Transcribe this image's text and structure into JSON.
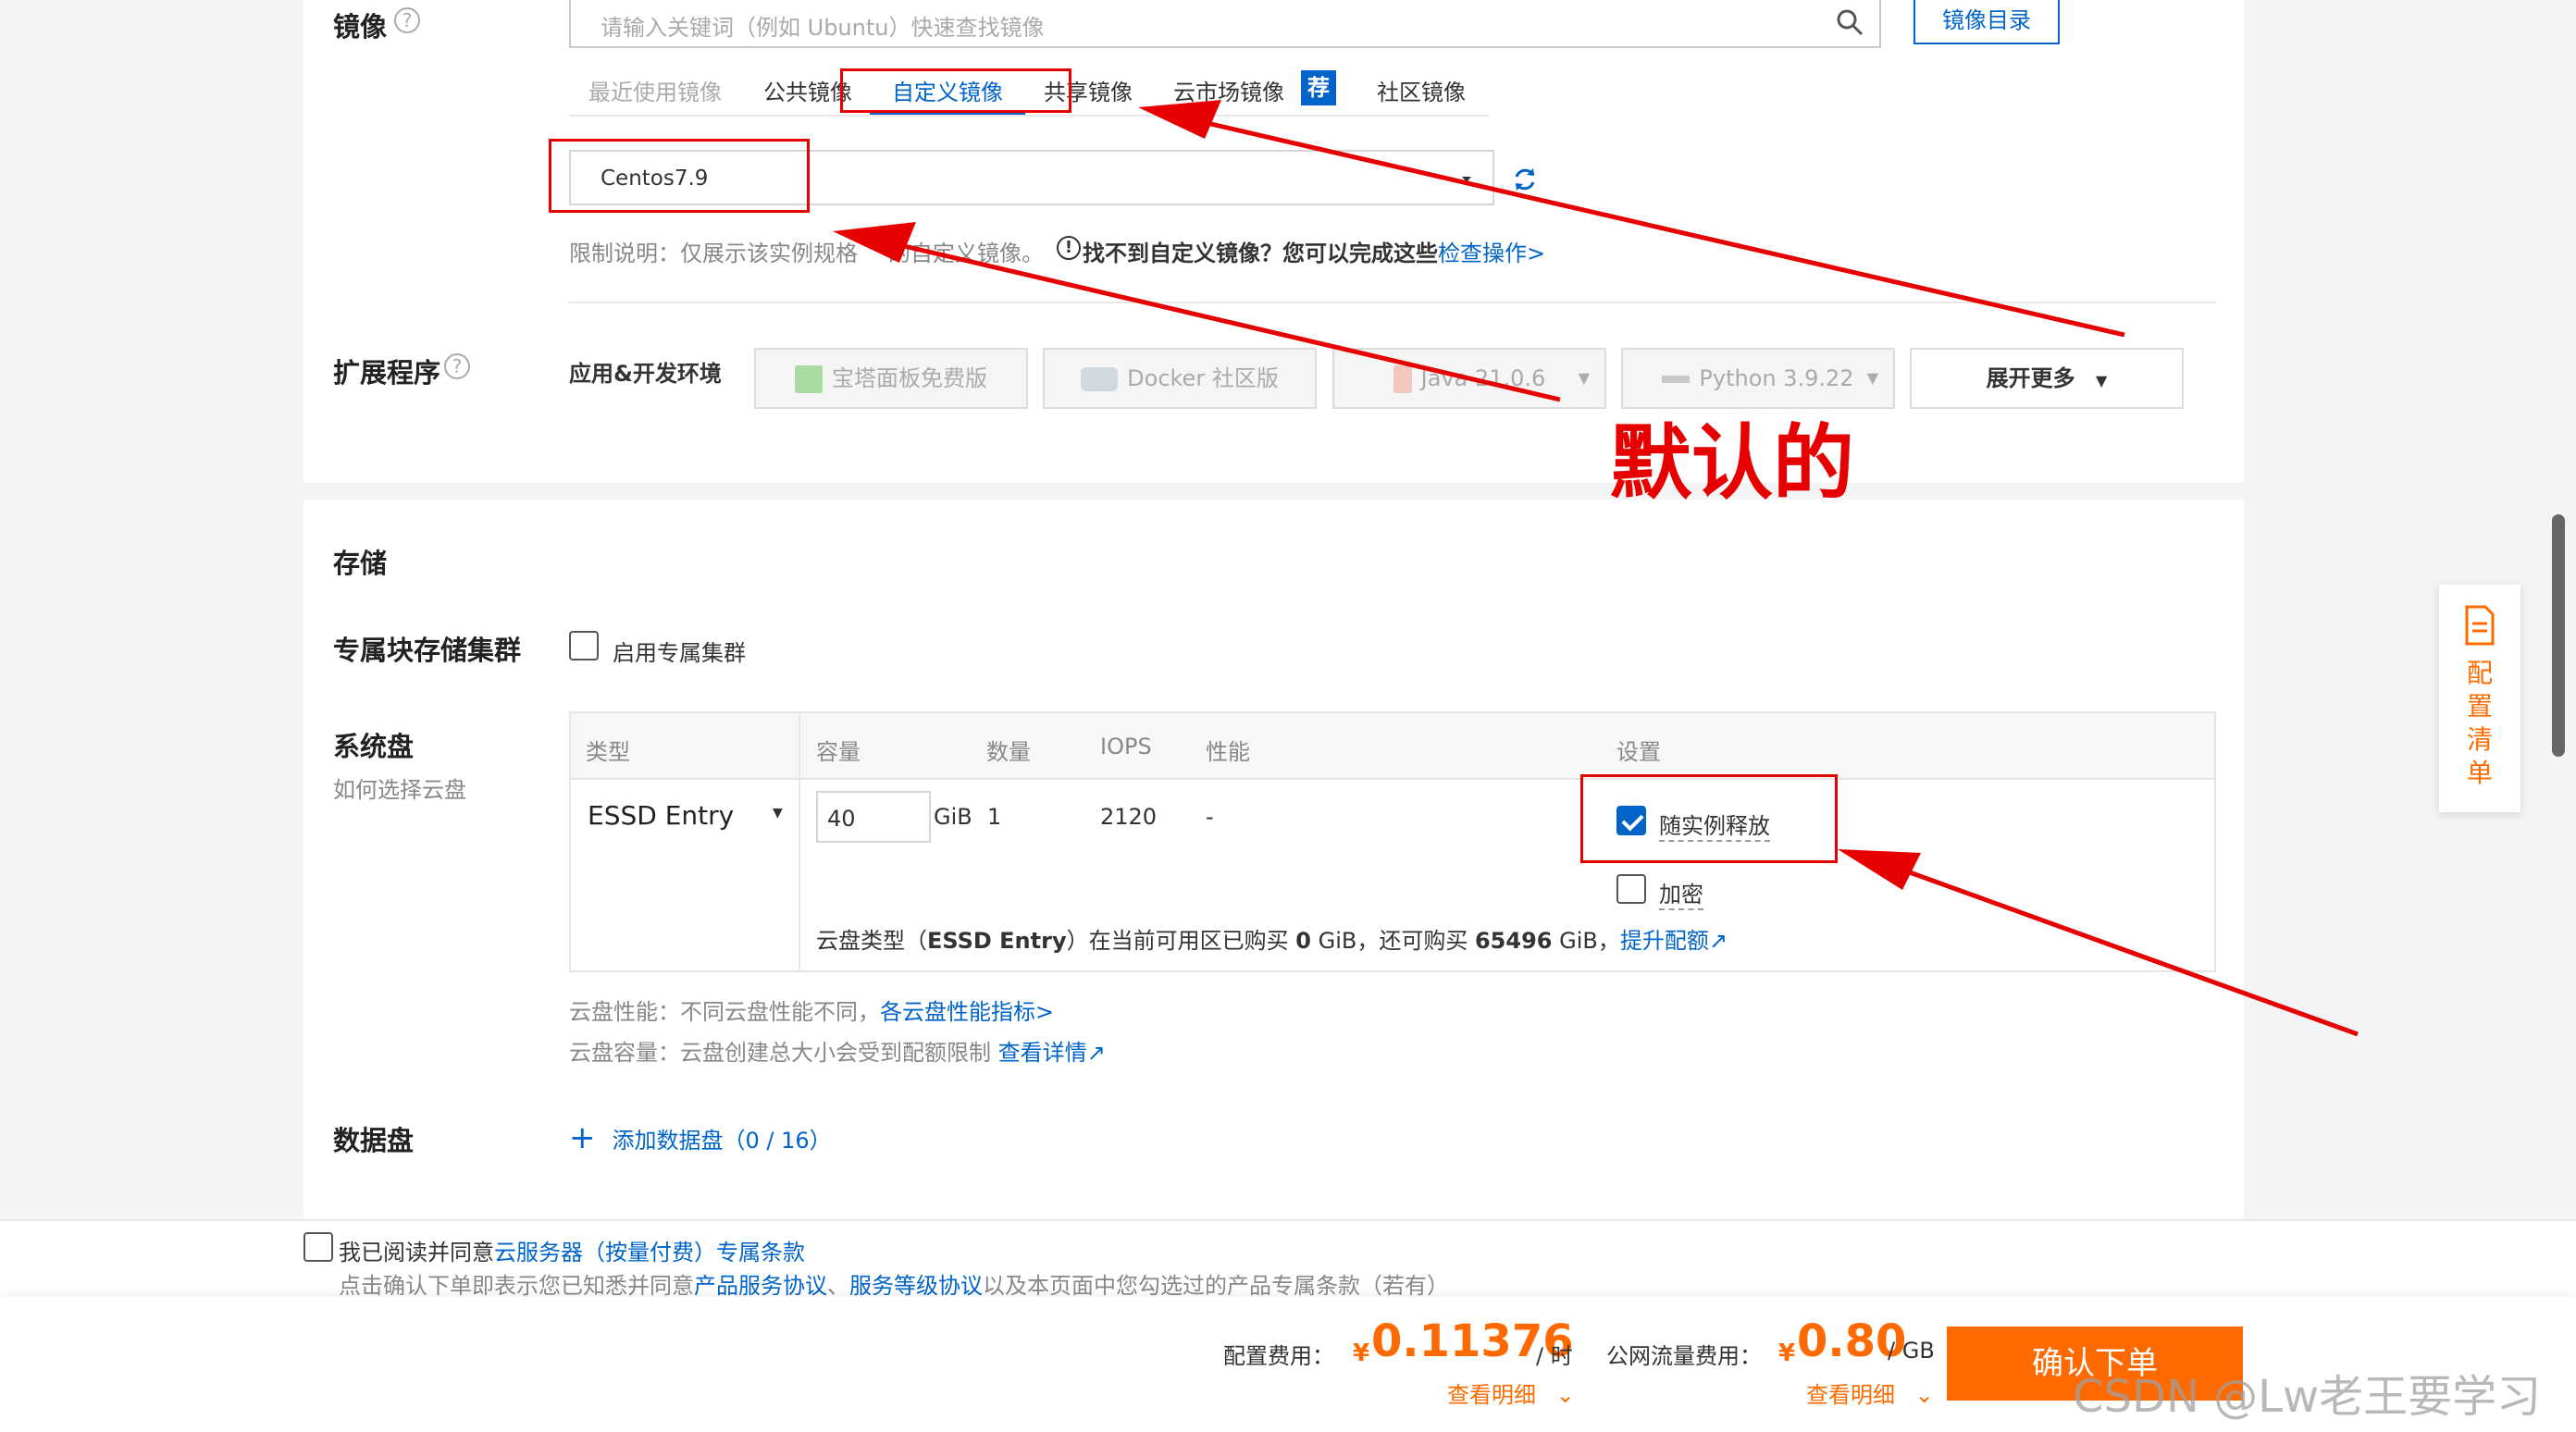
{
  "image_section": {
    "title": "镜像",
    "search_placeholder": "请输入关键词（例如 Ubuntu）快速查找镜像",
    "catalog_button": "镜像目录",
    "tabs": [
      "最近使用镜像",
      "公共镜像",
      "自定义镜像",
      "共享镜像",
      "云市场镜像",
      "社区镜像"
    ],
    "recommend_badge": "荐",
    "selected_image": "Centos7.9",
    "limit_note": "限制说明：仅展示该实例规格",
    "limit_note_tail": "的自定义镜像。",
    "not_found_text": "找不到自定义镜像？您可以完成这些",
    "check_link": "检查操作>"
  },
  "extension_section": {
    "title": "扩展程序",
    "env_label": "应用&开发环境",
    "chips": [
      "宝塔面板免费版",
      "Docker 社区版",
      "Java 21.0.6",
      "Python 3.9.22"
    ],
    "expand_more": "展开更多"
  },
  "annotation": {
    "default_label": "默认的"
  },
  "storage_section": {
    "title": "存储",
    "dedicated_cluster_label": "专属块存储集群",
    "enable_cluster": "启用专属集群",
    "system_disk_title": "系统盘",
    "how_to_choose": "如何选择云盘",
    "table_headers": [
      "类型",
      "容量",
      "数量",
      "IOPS",
      "性能",
      "设置"
    ],
    "disk_type": "ESSD Entry",
    "capacity": "40",
    "capacity_unit": "GiB",
    "quantity": "1",
    "iops": "2120",
    "performance": "-",
    "release_with_instance": "随实例释放",
    "encrypt": "加密",
    "quota_text_pre": "云盘类型（",
    "quota_type": "ESSD Entry",
    "quota_text_mid": "）在当前可用区已购买",
    "quota_bought": "0",
    "quota_text_mid2": "GiB，还可购买",
    "quota_available": "65496",
    "quota_text_end": "GiB，",
    "quota_link": "提升配额",
    "perf_note": "云盘性能：不同云盘性能不同，",
    "perf_link": "各云盘性能指标>",
    "capacity_note": "云盘容量：云盘创建总大小会受到配额限制",
    "capacity_link": "查看详情",
    "data_disk_title": "数据盘",
    "add_data_disk": "添加数据盘（0 / 16）"
  },
  "sidebar": {
    "label": [
      "配",
      "置",
      "清",
      "单"
    ]
  },
  "footer": {
    "agree_text": "我已阅读并同意",
    "agree_link": "云服务器（按量付费）专属条款",
    "notice_pre": "点击确认下单即表示您已知悉并同意",
    "notice_link1": "产品服务协议",
    "notice_sep": "、",
    "notice_link2": "服务等级协议",
    "notice_post": "以及本页面中您勾选过的产品专属条款（若有）",
    "config_fee_label": "配置费用：",
    "currency": "¥",
    "config_fee": "0.11376",
    "config_fee_unit": "/ 时",
    "traffic_fee_label": "公网流量费用：",
    "traffic_fee": "0.80",
    "traffic_fee_unit": "/ GB",
    "detail_link": "查看明细",
    "order_button": "确认下单",
    "watermark": "CSDN @Lw老王要学习"
  },
  "colors": {
    "accent_blue": "#0064c8",
    "price_orange": "#ff6a00",
    "annotation_red": "#e60000"
  }
}
